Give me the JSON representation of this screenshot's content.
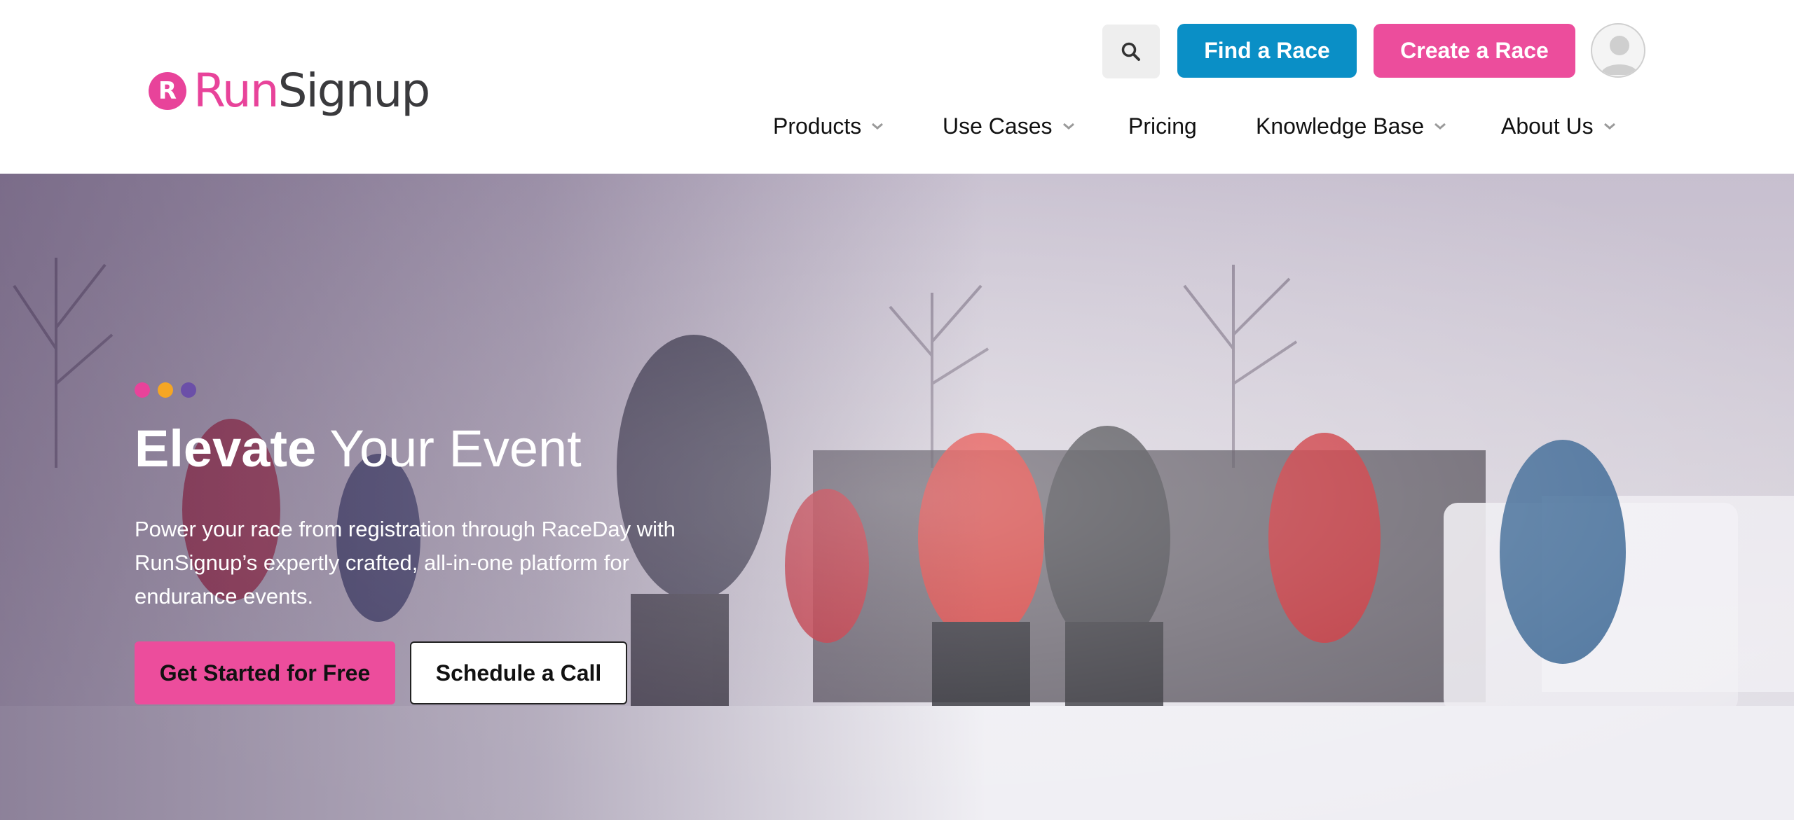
{
  "header": {
    "logo": {
      "mark": "R",
      "run": "Run",
      "signup": "Signup"
    },
    "search": {
      "icon": "search-icon"
    },
    "find_race_label": "Find a Race",
    "create_race_label": "Create a Race",
    "avatar": {
      "icon": "user-avatar-icon"
    }
  },
  "nav": {
    "items": [
      {
        "label": "Products",
        "has_dropdown": true
      },
      {
        "label": "Use Cases",
        "has_dropdown": true
      },
      {
        "label": "Pricing",
        "has_dropdown": false
      },
      {
        "label": "Knowledge Base",
        "has_dropdown": true
      },
      {
        "label": "About Us",
        "has_dropdown": true
      }
    ]
  },
  "hero": {
    "dots": [
      "#e8439a",
      "#f5a623",
      "#6b4fa8"
    ],
    "title_strong": "Elevate",
    "title_rest": " Your Event",
    "subtitle": "Power your race from registration through RaceDay with RunSignup’s expertly crafted, all-in-one platform for endurance events.",
    "cta_primary": "Get Started for Free",
    "cta_secondary": "Schedule a Call",
    "image": "snowshoe-race-start-photo"
  },
  "colors": {
    "brand_pink": "#ec4d9c",
    "brand_blue": "#0a8fc6",
    "logo_dark": "#3a3a3d"
  }
}
